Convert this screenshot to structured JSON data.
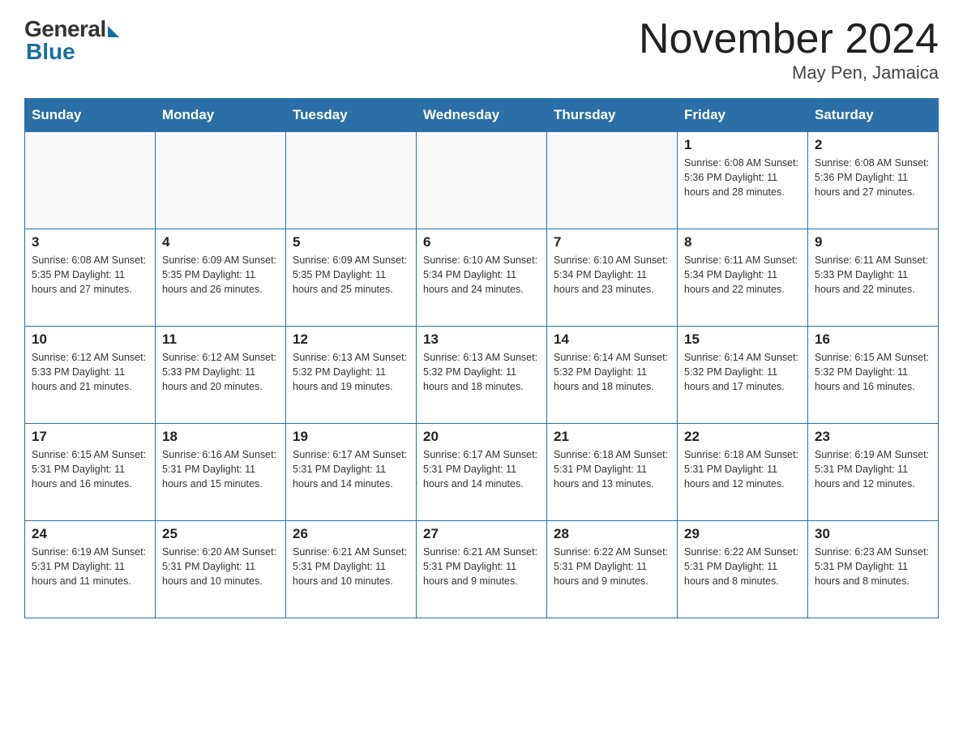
{
  "logo": {
    "general": "General",
    "blue": "Blue"
  },
  "title": "November 2024",
  "location": "May Pen, Jamaica",
  "days_of_week": [
    "Sunday",
    "Monday",
    "Tuesday",
    "Wednesday",
    "Thursday",
    "Friday",
    "Saturday"
  ],
  "weeks": [
    [
      {
        "day": "",
        "info": ""
      },
      {
        "day": "",
        "info": ""
      },
      {
        "day": "",
        "info": ""
      },
      {
        "day": "",
        "info": ""
      },
      {
        "day": "",
        "info": ""
      },
      {
        "day": "1",
        "info": "Sunrise: 6:08 AM\nSunset: 5:36 PM\nDaylight: 11 hours and 28 minutes."
      },
      {
        "day": "2",
        "info": "Sunrise: 6:08 AM\nSunset: 5:36 PM\nDaylight: 11 hours and 27 minutes."
      }
    ],
    [
      {
        "day": "3",
        "info": "Sunrise: 6:08 AM\nSunset: 5:35 PM\nDaylight: 11 hours and 27 minutes."
      },
      {
        "day": "4",
        "info": "Sunrise: 6:09 AM\nSunset: 5:35 PM\nDaylight: 11 hours and 26 minutes."
      },
      {
        "day": "5",
        "info": "Sunrise: 6:09 AM\nSunset: 5:35 PM\nDaylight: 11 hours and 25 minutes."
      },
      {
        "day": "6",
        "info": "Sunrise: 6:10 AM\nSunset: 5:34 PM\nDaylight: 11 hours and 24 minutes."
      },
      {
        "day": "7",
        "info": "Sunrise: 6:10 AM\nSunset: 5:34 PM\nDaylight: 11 hours and 23 minutes."
      },
      {
        "day": "8",
        "info": "Sunrise: 6:11 AM\nSunset: 5:34 PM\nDaylight: 11 hours and 22 minutes."
      },
      {
        "day": "9",
        "info": "Sunrise: 6:11 AM\nSunset: 5:33 PM\nDaylight: 11 hours and 22 minutes."
      }
    ],
    [
      {
        "day": "10",
        "info": "Sunrise: 6:12 AM\nSunset: 5:33 PM\nDaylight: 11 hours and 21 minutes."
      },
      {
        "day": "11",
        "info": "Sunrise: 6:12 AM\nSunset: 5:33 PM\nDaylight: 11 hours and 20 minutes."
      },
      {
        "day": "12",
        "info": "Sunrise: 6:13 AM\nSunset: 5:32 PM\nDaylight: 11 hours and 19 minutes."
      },
      {
        "day": "13",
        "info": "Sunrise: 6:13 AM\nSunset: 5:32 PM\nDaylight: 11 hours and 18 minutes."
      },
      {
        "day": "14",
        "info": "Sunrise: 6:14 AM\nSunset: 5:32 PM\nDaylight: 11 hours and 18 minutes."
      },
      {
        "day": "15",
        "info": "Sunrise: 6:14 AM\nSunset: 5:32 PM\nDaylight: 11 hours and 17 minutes."
      },
      {
        "day": "16",
        "info": "Sunrise: 6:15 AM\nSunset: 5:32 PM\nDaylight: 11 hours and 16 minutes."
      }
    ],
    [
      {
        "day": "17",
        "info": "Sunrise: 6:15 AM\nSunset: 5:31 PM\nDaylight: 11 hours and 16 minutes."
      },
      {
        "day": "18",
        "info": "Sunrise: 6:16 AM\nSunset: 5:31 PM\nDaylight: 11 hours and 15 minutes."
      },
      {
        "day": "19",
        "info": "Sunrise: 6:17 AM\nSunset: 5:31 PM\nDaylight: 11 hours and 14 minutes."
      },
      {
        "day": "20",
        "info": "Sunrise: 6:17 AM\nSunset: 5:31 PM\nDaylight: 11 hours and 14 minutes."
      },
      {
        "day": "21",
        "info": "Sunrise: 6:18 AM\nSunset: 5:31 PM\nDaylight: 11 hours and 13 minutes."
      },
      {
        "day": "22",
        "info": "Sunrise: 6:18 AM\nSunset: 5:31 PM\nDaylight: 11 hours and 12 minutes."
      },
      {
        "day": "23",
        "info": "Sunrise: 6:19 AM\nSunset: 5:31 PM\nDaylight: 11 hours and 12 minutes."
      }
    ],
    [
      {
        "day": "24",
        "info": "Sunrise: 6:19 AM\nSunset: 5:31 PM\nDaylight: 11 hours and 11 minutes."
      },
      {
        "day": "25",
        "info": "Sunrise: 6:20 AM\nSunset: 5:31 PM\nDaylight: 11 hours and 10 minutes."
      },
      {
        "day": "26",
        "info": "Sunrise: 6:21 AM\nSunset: 5:31 PM\nDaylight: 11 hours and 10 minutes."
      },
      {
        "day": "27",
        "info": "Sunrise: 6:21 AM\nSunset: 5:31 PM\nDaylight: 11 hours and 9 minutes."
      },
      {
        "day": "28",
        "info": "Sunrise: 6:22 AM\nSunset: 5:31 PM\nDaylight: 11 hours and 9 minutes."
      },
      {
        "day": "29",
        "info": "Sunrise: 6:22 AM\nSunset: 5:31 PM\nDaylight: 11 hours and 8 minutes."
      },
      {
        "day": "30",
        "info": "Sunrise: 6:23 AM\nSunset: 5:31 PM\nDaylight: 11 hours and 8 minutes."
      }
    ]
  ]
}
